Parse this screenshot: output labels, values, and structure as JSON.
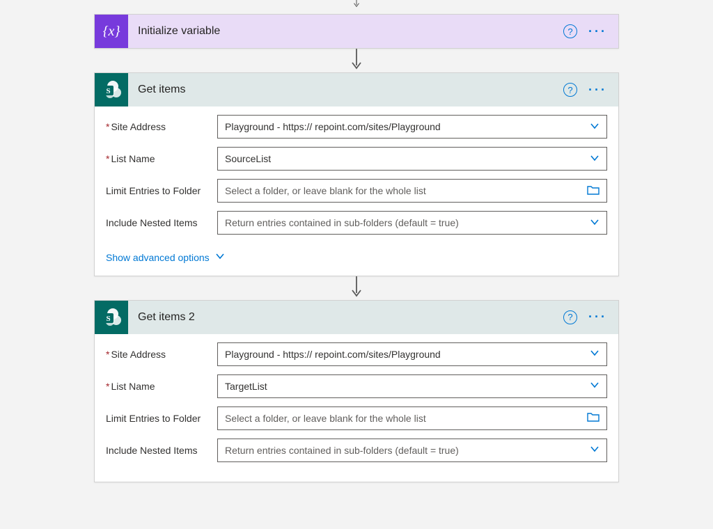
{
  "colors": {
    "accent": "#0078d4",
    "purple": "#773adc",
    "teal": "#036b64"
  },
  "labels": {
    "site_address": "Site Address",
    "list_name": "List Name",
    "limit_entries": "Limit Entries to Folder",
    "include_nested": "Include Nested Items",
    "show_advanced": "Show advanced options",
    "folder_placeholder": "Select a folder, or leave blank for the whole list",
    "nested_placeholder": "Return entries contained in sub-folders (default = true)"
  },
  "card1": {
    "title": "Initialize variable",
    "icon_glyph": "{x}"
  },
  "card2": {
    "title": "Get items",
    "icon_letter": "S",
    "site_address": "Playground - https://                            repoint.com/sites/Playground",
    "list_name": "SourceList"
  },
  "card3": {
    "title": "Get items 2",
    "icon_letter": "S",
    "site_address": "Playground - https://                            repoint.com/sites/Playground",
    "list_name": "TargetList"
  }
}
